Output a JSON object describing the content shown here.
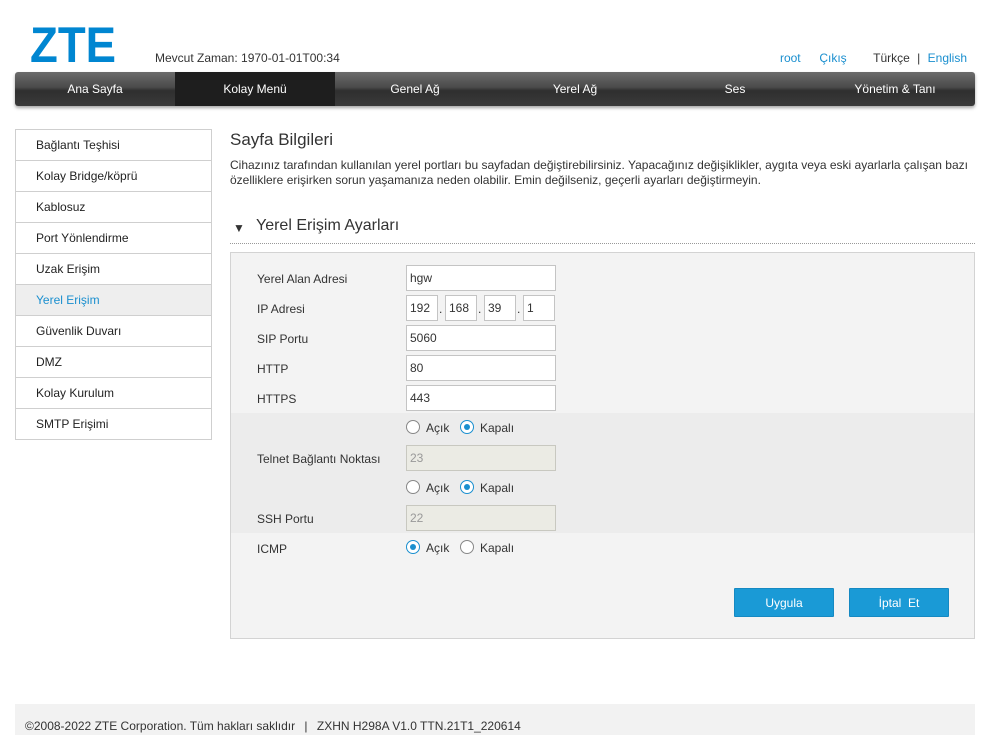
{
  "header": {
    "logo_text": "ZTE",
    "clock_label": "Mevcut Zaman: 1970-01-01T00:34",
    "user": "root",
    "logout": "Çıkış",
    "lang_current": "Türkçe",
    "lang_separator": "|",
    "lang_other": "English"
  },
  "nav": {
    "tabs": [
      {
        "label": "Ana Sayfa"
      },
      {
        "label": "Kolay Menü"
      },
      {
        "label": "Genel Ağ"
      },
      {
        "label": "Yerel Ağ"
      },
      {
        "label": "Ses"
      },
      {
        "label": "Yönetim & Tanı"
      }
    ],
    "active_index": 1
  },
  "sidebar": {
    "items": [
      {
        "label": "Bağlantı Teşhisi"
      },
      {
        "label": "Kolay Bridge/köprü"
      },
      {
        "label": "Kablosuz"
      },
      {
        "label": "Port Yönlendirme"
      },
      {
        "label": "Uzak Erişim"
      },
      {
        "label": "Yerel Erişim"
      },
      {
        "label": "Güvenlik Duvarı"
      },
      {
        "label": "DMZ"
      },
      {
        "label": "Kolay Kurulum"
      },
      {
        "label": "SMTP Erişimi"
      }
    ],
    "active_index": 5
  },
  "page": {
    "title": "Sayfa Bilgileri",
    "description": "Cihazınız tarafından kullanılan yerel portları bu sayfadan değiştirebilirsiniz. Yapacağınız değişiklikler, aygıta veya eski ayarlarla çalışan bazı özelliklere erişirken sorun yaşamanıza neden olabilir. Emin değilseniz, geçerli ayarları değiştirmeyin.",
    "section_title": "Yerel Erişim Ayarları"
  },
  "form": {
    "local_domain": {
      "label": "Yerel Alan Adresi",
      "value": "hgw"
    },
    "ip": {
      "label": "IP Adresi",
      "octets": [
        "192",
        "168",
        "39",
        "1"
      ],
      "dot": "."
    },
    "sip": {
      "label": "SIP Portu",
      "value": "5060"
    },
    "http": {
      "label": "HTTP",
      "value": "80"
    },
    "https": {
      "label": "HTTPS",
      "value": "443"
    },
    "telnet_toggle": {
      "on_label": "Açık",
      "off_label": "Kapalı",
      "selected": "off"
    },
    "telnet": {
      "label": "Telnet Bağlantı Noktası",
      "value": "23"
    },
    "ssh_toggle": {
      "on_label": "Açık",
      "off_label": "Kapalı",
      "selected": "off"
    },
    "ssh": {
      "label": "SSH Portu",
      "value": "22"
    },
    "icmp": {
      "label": "ICMP",
      "on_label": "Açık",
      "off_label": "Kapalı",
      "selected": "on"
    }
  },
  "buttons": {
    "apply": "Uygula",
    "cancel": "İptal  Et"
  },
  "footer": {
    "copyright": "©2008-2022 ZTE Corporation. Tüm hakları saklıdır",
    "separator": "|",
    "version": "ZXHN H298A V1.0 TTN.21T1_220614"
  },
  "colors": {
    "accent": "#1a8fcf",
    "button": "#1a9ad6",
    "logo": "#0086d1"
  }
}
